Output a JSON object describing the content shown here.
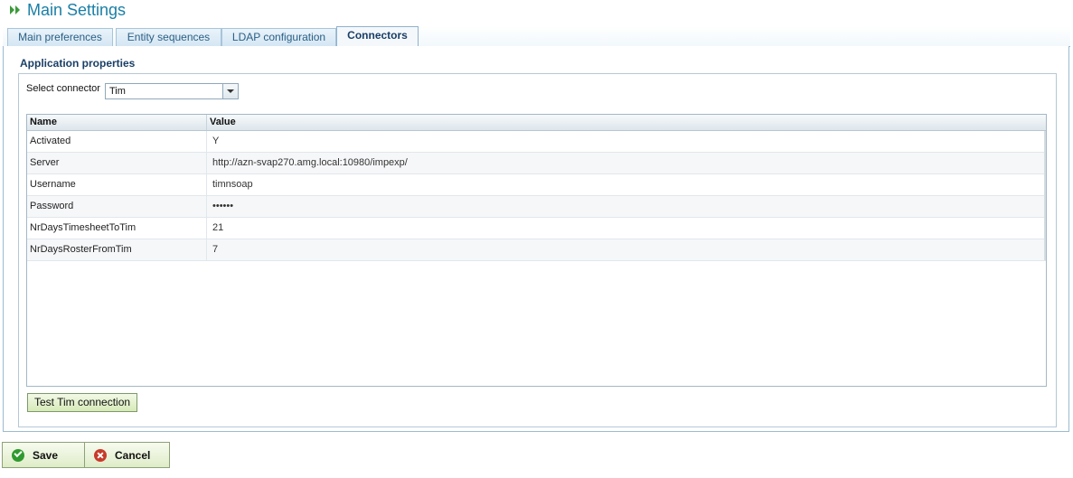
{
  "header": {
    "title": "Main Settings",
    "icon": "double-chevron-right-icon",
    "accent": "#1a7fa6"
  },
  "tabs": [
    {
      "label": "Main preferences",
      "active": false
    },
    {
      "label": "Entity sequences",
      "active": false
    },
    {
      "label": "LDAP configuration",
      "active": false
    },
    {
      "label": "Connectors",
      "active": true
    }
  ],
  "section": {
    "title": "Application properties"
  },
  "connector": {
    "label": "Select connector",
    "value": "Tim"
  },
  "grid": {
    "columns": [
      "Name",
      "Value"
    ],
    "rows": [
      {
        "name": "Activated",
        "value": "Y"
      },
      {
        "name": "Server",
        "value": "http://azn-svap270.amg.local:10980/impexp/"
      },
      {
        "name": "Username",
        "value": "timnsoap"
      },
      {
        "name": "Password",
        "value": "••••••"
      },
      {
        "name": "NrDaysTimesheetToTim",
        "value": "21"
      },
      {
        "name": "NrDaysRosterFromTim",
        "value": "7"
      }
    ]
  },
  "buttons": {
    "test": "Test Tim connection",
    "save": "Save",
    "cancel": "Cancel"
  }
}
